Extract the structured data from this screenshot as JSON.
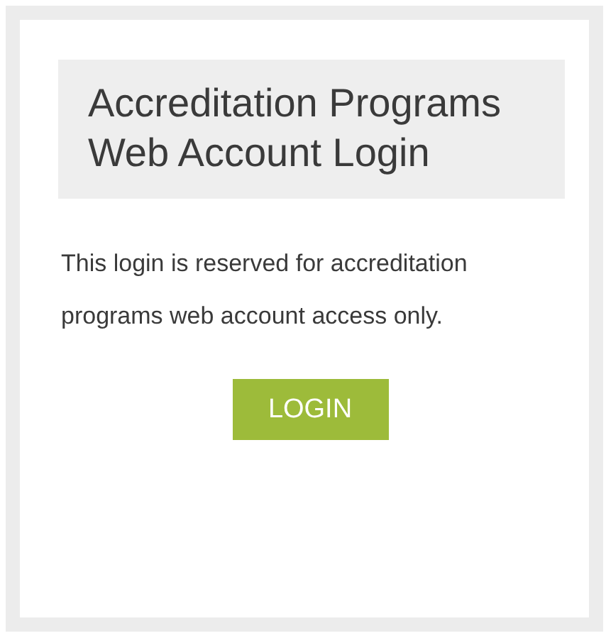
{
  "card": {
    "title": "Accreditation Programs Web Account Login",
    "message": "This login is reserved for accreditation programs web account access only.",
    "button": "LOGIN"
  }
}
